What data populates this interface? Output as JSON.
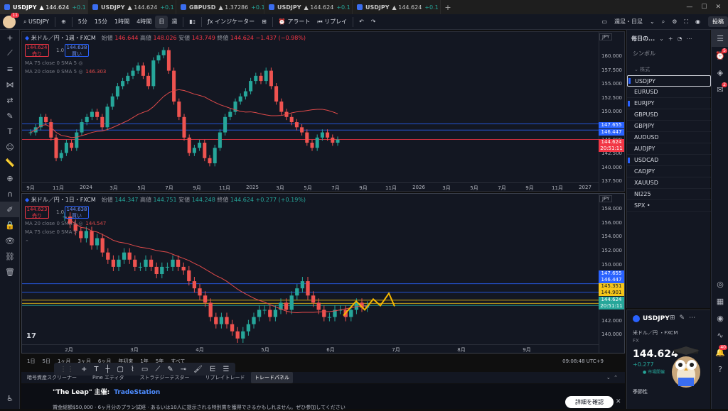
{
  "browser_tabs": [
    {
      "symbol": "USDJPY",
      "price": "▲ 144.624",
      "change": "+0.1",
      "active": true
    },
    {
      "symbol": "USDJPY",
      "price": "▲ 144.624",
      "change": "+0.1",
      "active": false
    },
    {
      "symbol": "GBPUSD",
      "price": "▲ 1.37286",
      "change": "+0.1",
      "active": false
    },
    {
      "symbol": "USDJPY",
      "price": "▲ 144.624",
      "change": "+0.1",
      "active": false
    },
    {
      "symbol": "USDJPY",
      "price": "▲ 144.624",
      "change": "+0.1",
      "active": false
    }
  ],
  "toolbar": {
    "avatar_badge": "11",
    "symbol": "USDJPY",
    "intervals": [
      "5分",
      "15分",
      "1時間",
      "4時間",
      "日",
      "週"
    ],
    "selected_interval": "日",
    "indicators": "インジケーター",
    "alert": "アラート",
    "replay": "リプレイ",
    "layout": "週足・日足",
    "publish": "投稿"
  },
  "pane1": {
    "title": "米ドル／円・1週・FXCM",
    "ohlc": {
      "open_label": "始値",
      "open": "146.644",
      "high_label": "高値",
      "high": "148.026",
      "low_label": "安値",
      "low": "143.749",
      "close_label": "終値",
      "close": "144.624",
      "change": "−1.437 (−0.98%)"
    },
    "sell_price": "144.624",
    "sell_label": "売り",
    "buy_price": "144.638",
    "buy_label": "買い",
    "lot": "1.0",
    "indicator1": "MA 75 close 0 SMA 5",
    "indicator2": "MA 20 close 0 SMA 5",
    "indicator2_value": "146.303",
    "currency": "JPY",
    "price_ticks": [
      "160.000",
      "157.500",
      "155.000",
      "152.500",
      "150.000",
      "147.500",
      "145.000",
      "142.500",
      "140.000",
      "137.500"
    ],
    "labels": [
      {
        "text": "147.655",
        "color": "#2962ff"
      },
      {
        "text": "146.447",
        "color": "#2962ff"
      },
      {
        "text": "144.624",
        "color": "#f23645"
      },
      {
        "text": "20:51:11",
        "color": "#f23645"
      }
    ],
    "time_ticks": [
      "9月",
      "11月",
      "2024",
      "3月",
      "5月",
      "7月",
      "9月",
      "11月",
      "2025",
      "3月",
      "5月",
      "7月",
      "9月",
      "11月",
      "2026",
      "3月",
      "5月",
      "7月",
      "9月",
      "11月",
      "2027"
    ]
  },
  "pane2": {
    "title": "米ドル／円・1日・FXCM",
    "ohlc": {
      "open_label": "始値",
      "open": "144.347",
      "high_label": "高値",
      "high": "144.751",
      "low_label": "安値",
      "low": "144.248",
      "close_label": "終値",
      "close": "144.624",
      "change": "+0.277 (+0.19%)"
    },
    "sell_price": "144.623",
    "sell_label": "売り",
    "buy_price": "144.638",
    "buy_label": "買い",
    "lot": "1.0",
    "indicator1": "MA 20 close 0 SMA 5",
    "indicator1_value": "144.547",
    "indicator2": "MA 75 close 0 SMA 5",
    "currency": "JPY",
    "price_ticks": [
      "158.000",
      "156.000",
      "154.000",
      "152.000",
      "150.000",
      "148.000",
      "146.000",
      "144.000",
      "142.000",
      "140.000"
    ],
    "labels": [
      {
        "text": "147.655",
        "color": "#2962ff"
      },
      {
        "text": "146.447",
        "color": "#2962ff"
      },
      {
        "text": "145.351",
        "color": "#f5c518"
      },
      {
        "text": "144.901",
        "color": "#f5c518"
      },
      {
        "text": "144.624",
        "color": "#26a69a"
      },
      {
        "text": "20:51:11",
        "color": "#26a69a"
      }
    ],
    "time_ticks": [
      "2月",
      "3月",
      "4月",
      "5月",
      "6月",
      "7月",
      "8月",
      "9月"
    ]
  },
  "timeframes": [
    "1日",
    "5日",
    "1ヶ月",
    "3ヶ月",
    "6ヶ月",
    "年初来",
    "1年",
    "5年",
    "すべて"
  ],
  "clock": "09:08:48 UTC+9",
  "bottom_tabs": [
    "暗号資産スクリーナー",
    "Pine エディタ",
    "ストラテジーテスター",
    "リプレイトレード"
  ],
  "tooltip": "トレードパネル",
  "promo": {
    "title": "\"The Leap\" 主催:",
    "brand": "TradeStation",
    "text": "賞金総額$50,000 · 6ヶ月分のプラン試経 · あるいは10人に提示される特別賞を獲得できるかもしれません。ぜひ参加してください",
    "button": "詳細を確認"
  },
  "watchlist": {
    "title": "毎日の...",
    "symbol_column": "シンボル",
    "group": "株式",
    "items": [
      "USDJPY",
      "EURUSD",
      "EURJPY",
      "GBPUSD",
      "GBPJPY",
      "AUDUSD",
      "AUDJPY",
      "USDCAD",
      "CADJPY",
      "XAUUSD",
      "NI225",
      "SPX"
    ],
    "selected": "USDJPY"
  },
  "details": {
    "symbol": "USDJPY",
    "name": "米ドル／円 ・FXCM",
    "type": "FX",
    "price": "144.624",
    "change": "+0.277",
    "status": "● 市場開催",
    "season": "季節性"
  },
  "right_badges": [
    "5",
    "2",
    "40"
  ],
  "colors": {
    "up": "#26a69a",
    "down": "#ef5350",
    "ma": "#e04a4a",
    "accent": "#2962ff",
    "zigzag": "#f5b700"
  }
}
